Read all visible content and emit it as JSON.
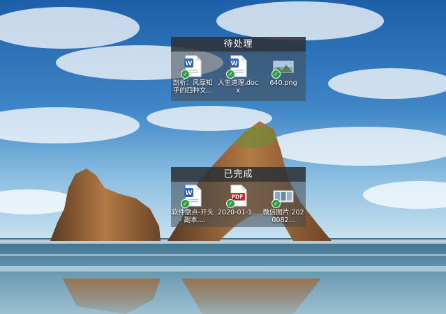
{
  "fences": [
    {
      "title": "待处理",
      "files": [
        {
          "name": "剖析：风靡知乎的四种文...",
          "icon": "word-doc-icon"
        },
        {
          "name": "人生道理.docx",
          "icon": "word-doc-icon"
        },
        {
          "name": "640.png",
          "icon": "image-thumbnail-icon"
        }
      ]
    },
    {
      "title": "已完成",
      "files": [
        {
          "name": "软件盘点-开头 - 副本....",
          "icon": "word-doc-icon"
        },
        {
          "name": "2020-01-1...",
          "icon": "pdf-icon"
        },
        {
          "name": "微信图片 2020082...",
          "icon": "image-thumbnail-icon"
        }
      ]
    }
  ],
  "icons": {
    "word_badge": "W",
    "pdf_badge": "PDF",
    "check": "✓"
  },
  "colors": {
    "word_blue": "#2b6fd6",
    "pdf_red": "#d82c2c",
    "sync_green": "#2ea043",
    "fence_title_bg": "#282c32"
  }
}
